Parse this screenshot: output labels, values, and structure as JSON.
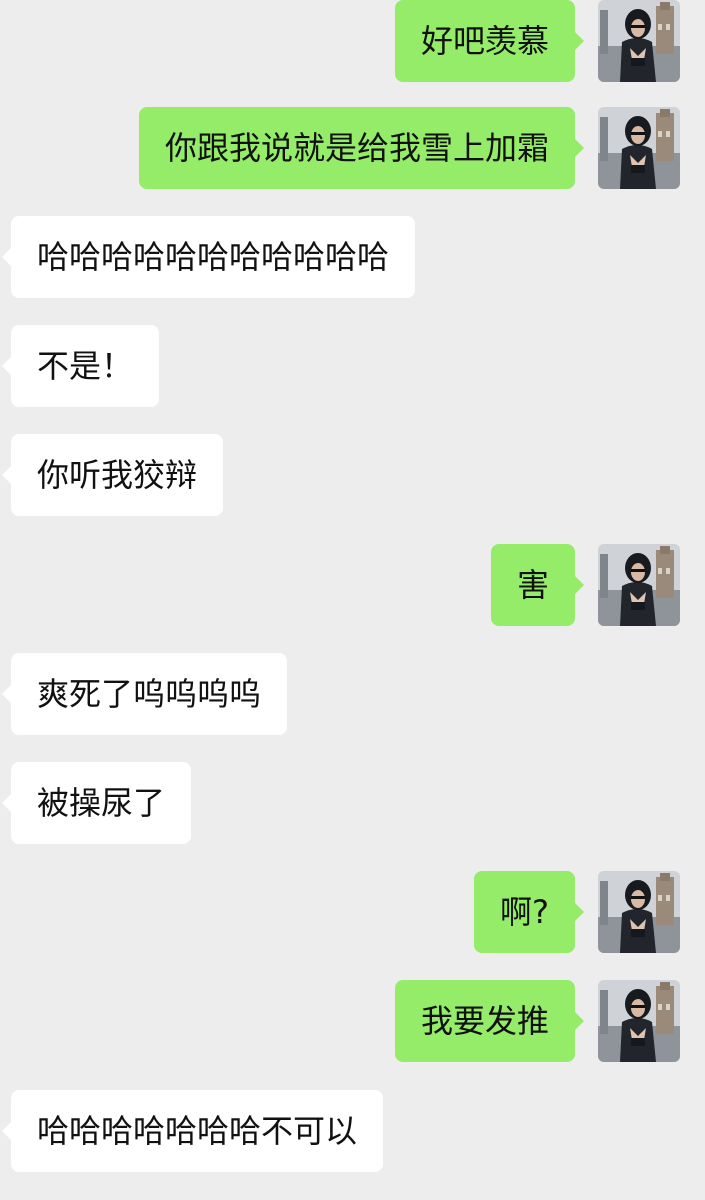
{
  "messages": [
    {
      "side": "out",
      "text": "好吧羡慕",
      "avatar": "user-avatar-icon"
    },
    {
      "side": "out",
      "text": "你跟我说就是给我雪上加霜",
      "avatar": "user-avatar-icon"
    },
    {
      "side": "in",
      "text": "哈哈哈哈哈哈哈哈哈哈哈"
    },
    {
      "side": "in",
      "text": "不是！"
    },
    {
      "side": "in",
      "text": "你听我狡辩"
    },
    {
      "side": "out",
      "text": "害",
      "avatar": "user-avatar-icon"
    },
    {
      "side": "in",
      "text": "爽死了呜呜呜呜"
    },
    {
      "side": "in",
      "text": "被操尿了"
    },
    {
      "side": "out",
      "text": "啊?",
      "avatar": "user-avatar-icon"
    },
    {
      "side": "out",
      "text": "我要发推",
      "avatar": "user-avatar-icon"
    },
    {
      "side": "in",
      "text": "哈哈哈哈哈哈哈不可以"
    }
  ],
  "colors": {
    "background": "#ededed",
    "outgoing_bubble": "#95ec69",
    "incoming_bubble": "#ffffff",
    "text": "#111111"
  }
}
